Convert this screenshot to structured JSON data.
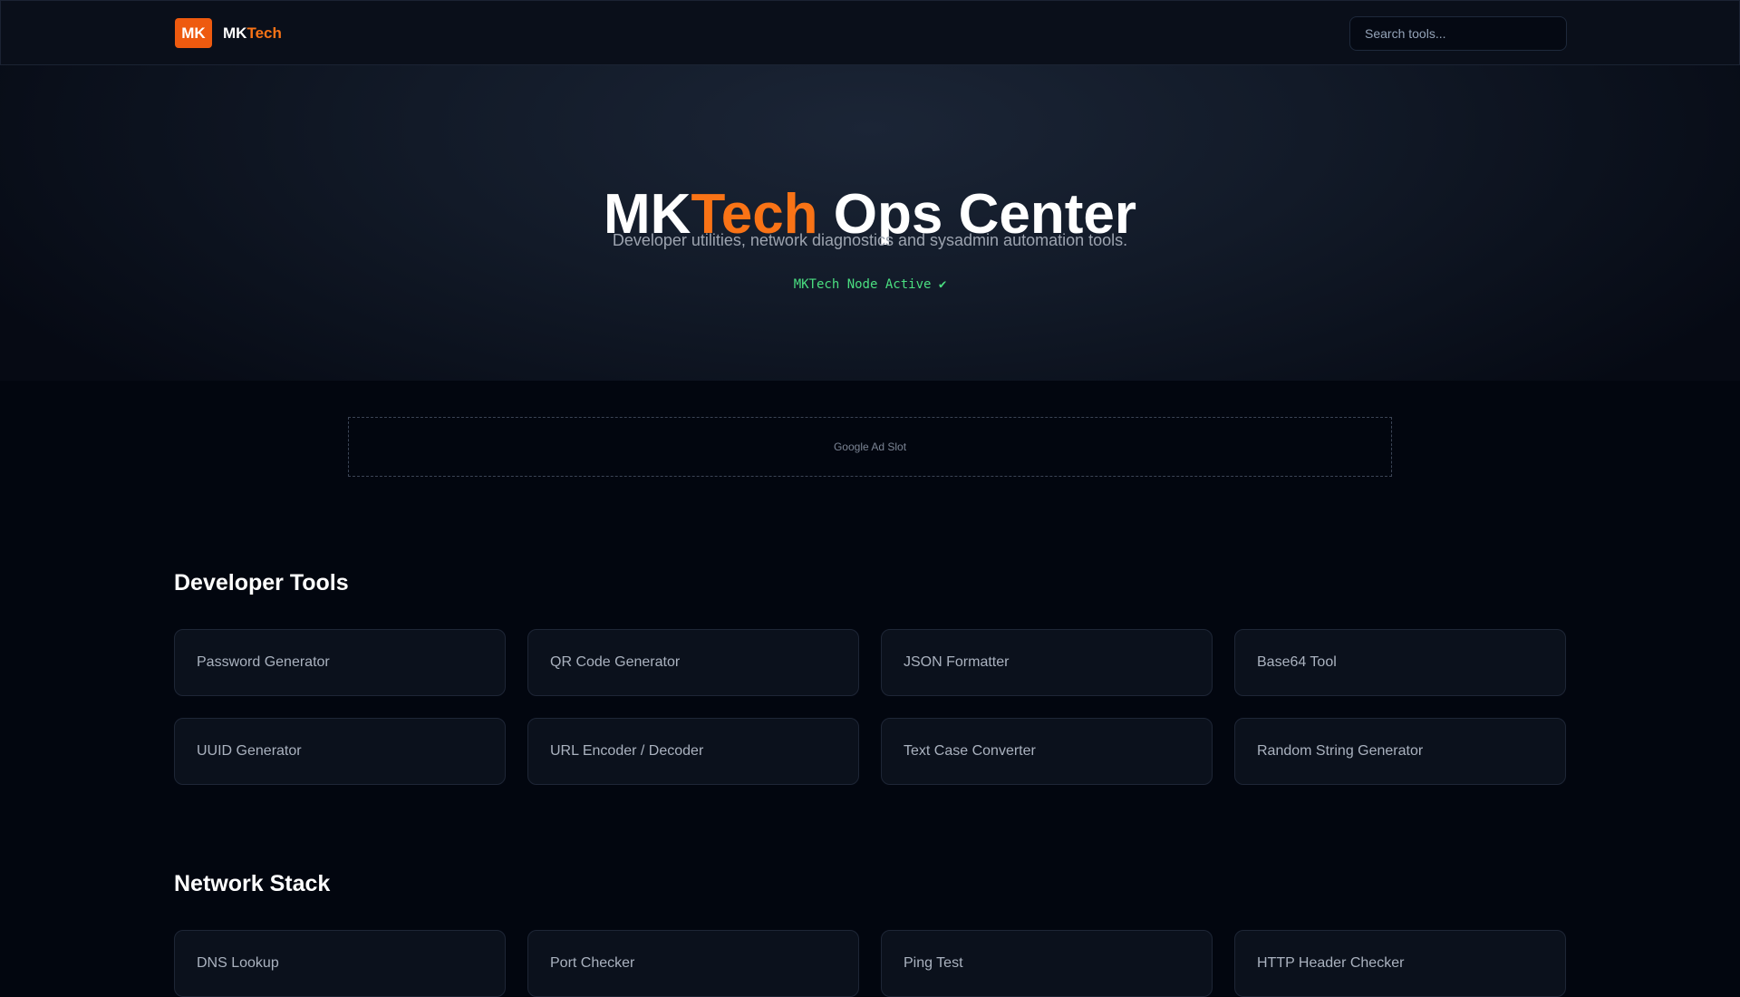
{
  "header": {
    "logo_badge": "MK",
    "brand_prefix": "MK",
    "brand_accent": "Tech",
    "search_placeholder": "Search tools..."
  },
  "hero": {
    "title_prefix": "MK",
    "title_accent": "Tech",
    "title_suffix": " Ops Center",
    "subtitle": "Developer utilities, network diagnostics and sysadmin automation tools.",
    "status": "MKTech Node Active ✔"
  },
  "ad": {
    "label": "Google Ad Slot"
  },
  "sections": {
    "developer": {
      "title": "Developer Tools",
      "tools": [
        "Password Generator",
        "QR Code Generator",
        "JSON Formatter",
        "Base64 Tool",
        "UUID Generator",
        "URL Encoder / Decoder",
        "Text Case Converter",
        "Random String Generator"
      ]
    },
    "network": {
      "title": "Network Stack",
      "tools": [
        "DNS Lookup",
        "Port Checker",
        "Ping Test",
        "HTTP Header Checker"
      ]
    }
  },
  "colors": {
    "accent": "#f97316",
    "logo_badge": "#ee5a0f",
    "status": "#4ade80",
    "background": "#02060f"
  }
}
